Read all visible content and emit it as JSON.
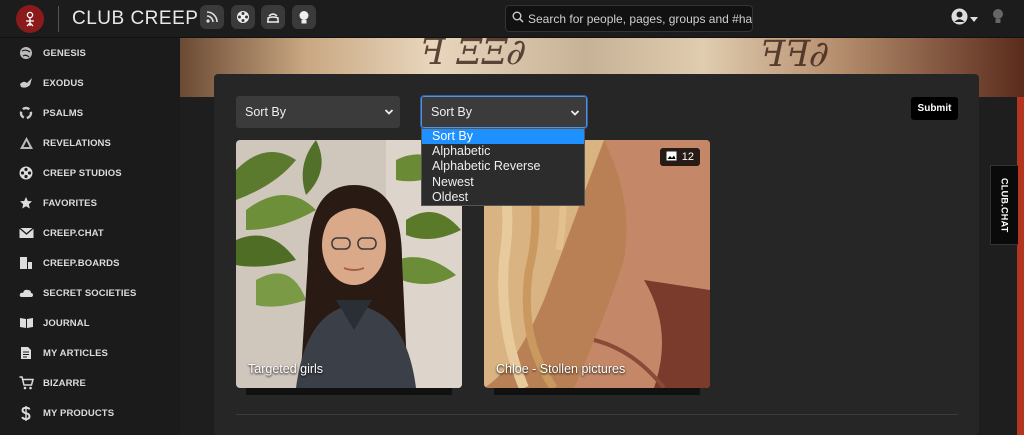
{
  "topbar": {
    "brand": "CLUB CREEP",
    "search_placeholder": "Search for people, pages, groups and #hashtags",
    "nav_icons": [
      "rss-icon",
      "film-reel-icon",
      "cake-icon",
      "lightbulb-badge-icon"
    ]
  },
  "sidebar": {
    "items": [
      {
        "label": "GENESIS",
        "icon": "globe-icon"
      },
      {
        "label": "EXODUS",
        "icon": "dove-icon"
      },
      {
        "label": "PSALMS",
        "icon": "refresh-icon"
      },
      {
        "label": "REVELATIONS",
        "icon": "triangle-icon"
      },
      {
        "label": "CREEP STUDIOS",
        "icon": "film-reel-icon"
      },
      {
        "label": "FAVORITES",
        "icon": "star-icon"
      },
      {
        "label": "CREEP.CHAT",
        "icon": "envelope-icon"
      },
      {
        "label": "CREEP.BOARDS",
        "icon": "boards-icon"
      },
      {
        "label": "SECRET SOCIETIES",
        "icon": "cloud-icon"
      },
      {
        "label": "JOURNAL",
        "icon": "book-icon"
      },
      {
        "label": "MY ARTICLES",
        "icon": "document-icon"
      },
      {
        "label": "BIZARRE",
        "icon": "cart-icon"
      },
      {
        "label": "MY PRODUCTS",
        "icon": "dollar-icon"
      }
    ]
  },
  "filters": {
    "sort_left": "Sort By",
    "sort_right": "Sort By",
    "submit_label": "Submit",
    "options": [
      "Sort By",
      "Alphabetic",
      "Alphabetic Reverse",
      "Newest",
      "Oldest"
    ],
    "selected_index": 0
  },
  "albums": [
    {
      "title": "Targeted girls"
    },
    {
      "title": "Chloe - Stollen pictures",
      "photo_count": "12"
    }
  ],
  "chat_tab": "CLUB.CHAT",
  "colors": {
    "accent_blue": "#1e90ff",
    "brand_red": "#8b1a1a",
    "panel_bg": "#262626"
  }
}
